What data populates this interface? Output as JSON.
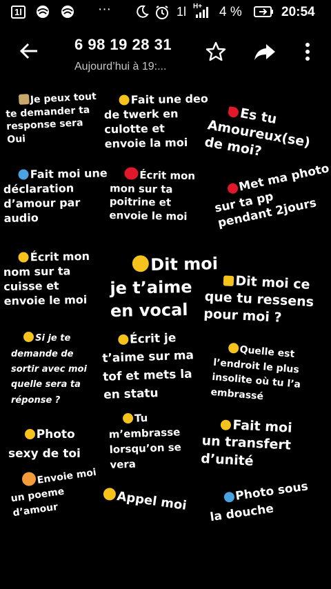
{
  "status_bar": {
    "sim1": "1l",
    "dots": "···",
    "network": "H+",
    "battery": "4 %",
    "time": "20:54"
  },
  "header": {
    "title": "6 98 19 28 31",
    "subtitle": "Aujourd’hui à 19:...",
    "icons": [
      "back-arrow-icon",
      "star-icon",
      "share-icon",
      "more-vert-icon"
    ]
  },
  "image_text": {
    "m1": "Je peux tout\nte demander ta\nresponse sera\nOui",
    "m2": "Fait une deo\nde twerk en\nculotte et\nenvoie la moi",
    "m3": "Es tu\nAmoureux(se)\nde moi?",
    "m4": "Fait moi une\ndéclaration\nd’amour par\naudio",
    "m5": "Écrit mon\nmon sur ta\npoitrine et\nenvoie le moi",
    "m6": "Met ma photo\nsur ta pp\npendant 2jours",
    "m7": "Écrit mon\nnom sur ta\ncuisse et\nenvoie le moi",
    "m8": "Dit moi\nje t’aime\nen vocal",
    "m9": "Dit moi ce\nque tu ressens\npour moi ?",
    "m10": "Si je te\ndemande de\nsortir avec moi\nquelle sera ta\nréponse ?",
    "m11": "Écrit je\nt’aime sur ma\ntof et mets la\nen statu",
    "m12": "Quelle est\nl’endroit le plus\ninsolite où tu l’a\nembrassé",
    "m13": "Photo\nsexy de toi",
    "m14": "Tu\nm’embrasse\nlorsqu’on se\nvera",
    "m15": "Fait moi\nun transfert\nd’unité",
    "m16": "Envoie moi\nun poeme\nd’amour",
    "m17": "Appel moi",
    "m18": "Photo sous\nla douche"
  },
  "colors": {
    "background": "#000000",
    "text": "#ffffff",
    "subtitle": "#c8c8c8",
    "emoji_yellow": "#f6c21c",
    "emoji_red": "#e0182a",
    "emoji_blue": "#4aa3e0"
  }
}
